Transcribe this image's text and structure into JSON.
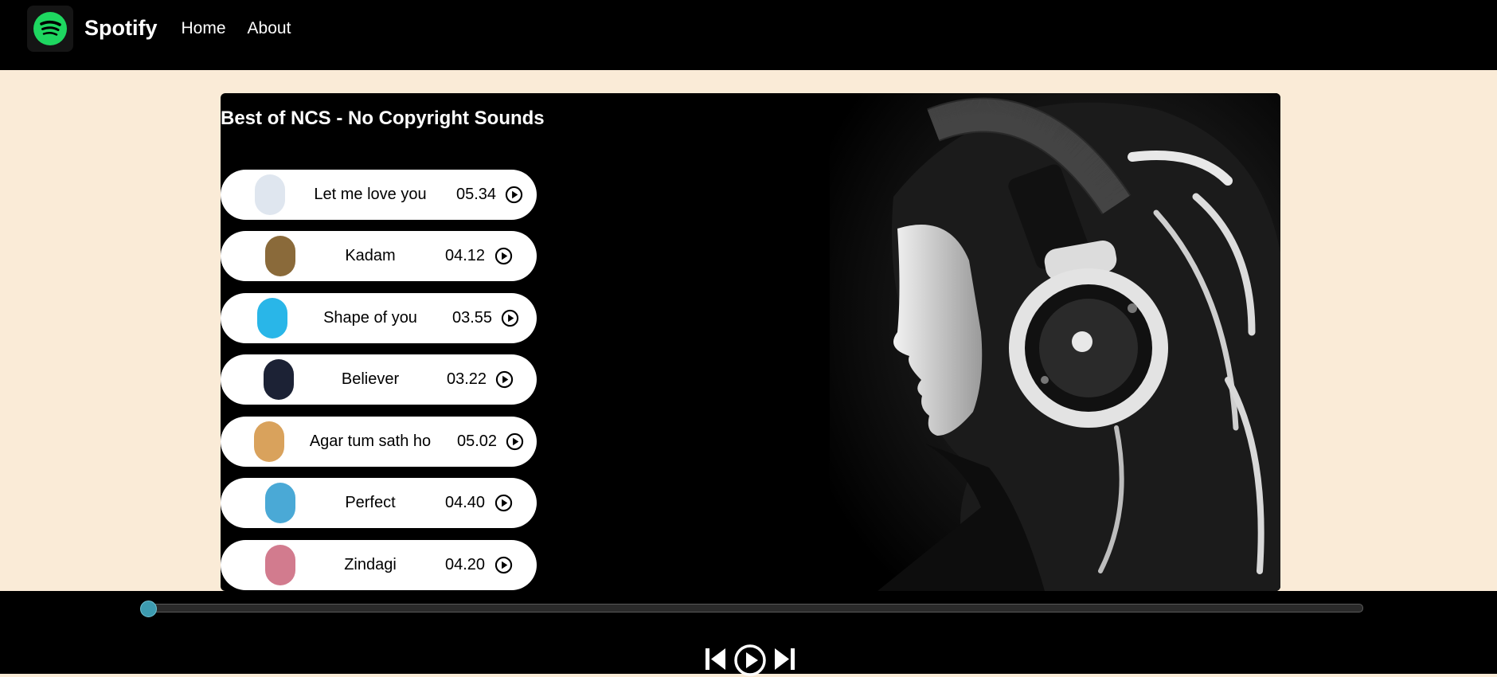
{
  "nav": {
    "brand": "Spotify",
    "links": [
      "Home",
      "About"
    ]
  },
  "playlist": {
    "title": "Best of NCS - No Copyright Sounds",
    "songs": [
      {
        "name": "Let me love you",
        "time": "05.34",
        "cover_color": "#dfe6ef"
      },
      {
        "name": "Kadam",
        "time": "04.12",
        "cover_color": "#8a6a3a"
      },
      {
        "name": "Shape of you",
        "time": "03.55",
        "cover_color": "#29b6e8"
      },
      {
        "name": "Believer",
        "time": "03.22",
        "cover_color": "#1c2235"
      },
      {
        "name": "Agar tum sath ho",
        "time": "05.02",
        "cover_color": "#d9a25c"
      },
      {
        "name": "Perfect",
        "time": "04.40",
        "cover_color": "#4aa9d6"
      },
      {
        "name": "Zindagi",
        "time": "04.20",
        "cover_color": "#d27b8e"
      }
    ]
  },
  "player": {
    "progress": 0,
    "controls": [
      "previous-icon",
      "play-icon",
      "next-icon"
    ]
  },
  "colors": {
    "background": "#faebd7",
    "nav": "#000000",
    "accent": "#1ed760",
    "progress": "#3d9bb0"
  }
}
